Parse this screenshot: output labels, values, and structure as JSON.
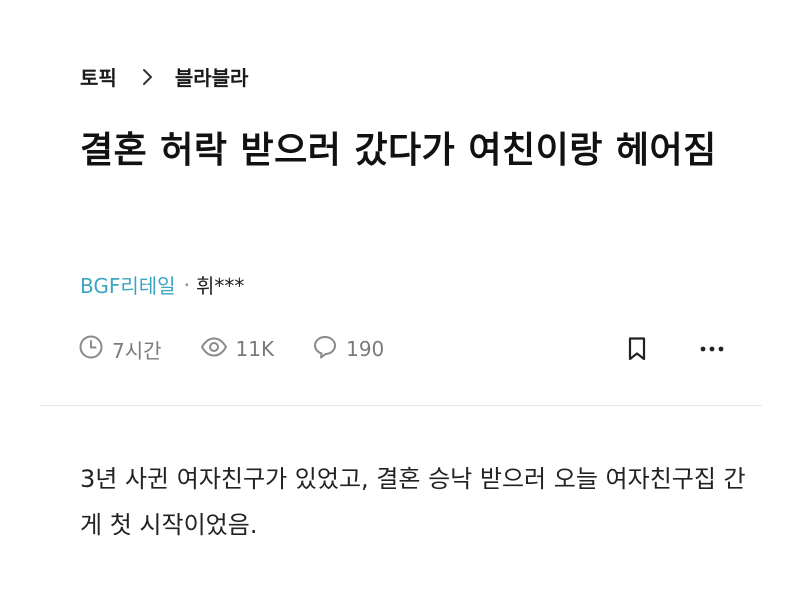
{
  "breadcrumb": {
    "topic_label": "토픽",
    "current_label": "블라블라"
  },
  "post": {
    "title": "결혼 허락 받으러 갔다가 여친이랑 헤어짐",
    "company": "BGF리테일",
    "separator": "·",
    "author": "휘***",
    "time_ago": "7시간",
    "views": "11K",
    "comments": "190",
    "body": "3년 사귄 여자친구가 있었고, 결혼 승낙 받으러 오늘 여자친구집 간 게 첫 시작이었음."
  },
  "icons": {
    "breadcrumb_separator": "chevron-right-icon",
    "time": "clock-icon",
    "views": "eye-icon",
    "comments": "comment-icon",
    "bookmark": "bookmark-icon",
    "more": "more-dots-icon"
  },
  "colors": {
    "company": "#3aa6c0",
    "meta_text": "#7a7a7a",
    "divider": "#e6e6e6",
    "title": "#111111"
  }
}
